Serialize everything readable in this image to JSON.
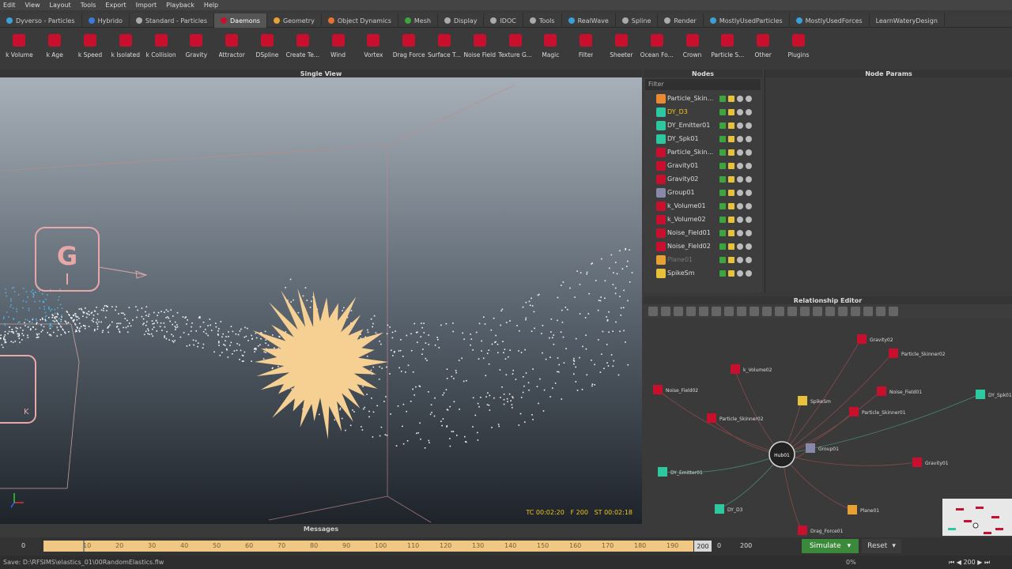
{
  "menu": [
    "Edit",
    "View",
    "Layout",
    "Tools",
    "Export",
    "Import",
    "Playback",
    "Help"
  ],
  "tabs": [
    {
      "label": "Dyverso - Particles",
      "icon": "dyverso-icon",
      "color": "#3aa0d8",
      "active": false
    },
    {
      "label": "Hybrido",
      "icon": "hybrido-icon",
      "color": "#3a7ad8",
      "active": false
    },
    {
      "label": "Standard - Particles",
      "icon": "particles-icon",
      "color": "#aaaaaa",
      "active": false
    },
    {
      "label": "Daemons",
      "icon": "daemon-icon",
      "color": "#c8102e",
      "active": true
    },
    {
      "label": "Geometry",
      "icon": "geometry-icon",
      "color": "#e8a030",
      "active": false
    },
    {
      "label": "Object Dynamics",
      "icon": "dynamics-icon",
      "color": "#e87030",
      "active": false
    },
    {
      "label": "Mesh",
      "icon": "mesh-icon",
      "color": "#3ca53c",
      "active": false
    },
    {
      "label": "Display",
      "icon": "display-icon",
      "color": "#aaaaaa",
      "active": false
    },
    {
      "label": "IDOC",
      "icon": "idoc-icon",
      "color": "#aaaaaa",
      "active": false
    },
    {
      "label": "Tools",
      "icon": "tools-icon",
      "color": "#aaaaaa",
      "active": false
    },
    {
      "label": "RealWave",
      "icon": "realwave-icon",
      "color": "#3aa0d8",
      "active": false
    },
    {
      "label": "Spline",
      "icon": "spline-icon",
      "color": "#aaaaaa",
      "active": false
    },
    {
      "label": "Render",
      "icon": "render-icon",
      "color": "#aaaaaa",
      "active": false
    },
    {
      "label": "MostlyUsedParticles",
      "icon": "favorites-icon",
      "color": "#3aa0d8",
      "active": false
    },
    {
      "label": "MostlyUsedForces",
      "icon": "favorites-icon",
      "color": "#3aa0d8",
      "active": false
    },
    {
      "label": "LearnWateryDesign",
      "icon": "",
      "color": "",
      "active": false
    }
  ],
  "shelf": [
    "k Volume",
    "k Age",
    "k Speed",
    "k Isolated",
    "k Collision",
    "Gravity",
    "Attractor",
    "DSpline",
    "Create Te...",
    "Wind",
    "Vortex",
    "Drag Force",
    "Surface T...",
    "Noise Field",
    "Texture G...",
    "Magic",
    "Filter",
    "Sheeter",
    "Ocean Fo...",
    "Crown",
    "Particle S...",
    "Other",
    "Plugins"
  ],
  "viewport": {
    "title": "Single View",
    "tc": "TC 00:02:20",
    "frame": "F 200",
    "st": "ST 00:02:18",
    "gizmo_g": "G",
    "gizmo_k": "K"
  },
  "nodes": {
    "title": "Nodes",
    "filter_placeholder": "Filter",
    "items": [
      {
        "name": "Particle_Skin...",
        "color": "#e88a30"
      },
      {
        "name": "DY_D3",
        "color": "#2ec8a0",
        "highlight": true
      },
      {
        "name": "DY_Emitter01",
        "color": "#2ec8a0"
      },
      {
        "name": "DY_Spk01",
        "color": "#2ec8a0"
      },
      {
        "name": "Particle_Skin...",
        "color": "#c8102e"
      },
      {
        "name": "Gravity01",
        "color": "#c8102e"
      },
      {
        "name": "Gravity02",
        "color": "#c8102e"
      },
      {
        "name": "Group01",
        "color": "#8888aa"
      },
      {
        "name": "k_Volume01",
        "color": "#c8102e"
      },
      {
        "name": "k_Volume02",
        "color": "#c8102e"
      },
      {
        "name": "Noise_Field01",
        "color": "#c8102e"
      },
      {
        "name": "Noise_Field02",
        "color": "#c8102e"
      },
      {
        "name": "Plane01",
        "color": "#e8a030",
        "dim": true
      },
      {
        "name": "SpikeSm",
        "color": "#e8c13c"
      }
    ]
  },
  "params": {
    "title": "Node Params"
  },
  "relationship": {
    "title": "Relationship Editor",
    "hub": "Hub01",
    "nodes": [
      {
        "label": "Gravity02",
        "color": "#c8102e"
      },
      {
        "label": "Particle_Skinner02",
        "color": "#c8102e"
      },
      {
        "label": "k_Volume02",
        "color": "#c8102e"
      },
      {
        "label": "Noise_Field02",
        "color": "#c8102e"
      },
      {
        "label": "SpikeSm",
        "color": "#e8c13c"
      },
      {
        "label": "Noise_Field01",
        "color": "#c8102e"
      },
      {
        "label": "Particle_Skinner01",
        "color": "#c8102e"
      },
      {
        "label": "Particle_Skinner02",
        "color": "#c8102e"
      },
      {
        "label": "Group01",
        "color": "#8888aa"
      },
      {
        "label": "DY_Spk01",
        "color": "#2ec8a0"
      },
      {
        "label": "DY_Emitter01",
        "color": "#2ec8a0"
      },
      {
        "label": "Gravity01",
        "color": "#c8102e"
      },
      {
        "label": "DY_D3",
        "color": "#2ec8a0"
      },
      {
        "label": "Drag_Force01",
        "color": "#c8102e"
      },
      {
        "label": "Plane01",
        "color": "#e8a030"
      }
    ]
  },
  "messages": {
    "title": "Messages"
  },
  "timeline": {
    "start": "0",
    "ticks": [
      "10",
      "20",
      "30",
      "40",
      "50",
      "60",
      "70",
      "80",
      "90",
      "100",
      "110",
      "120",
      "130",
      "140",
      "150",
      "160",
      "170",
      "180",
      "190"
    ],
    "current": "200",
    "range_start": "0",
    "range_end": "200",
    "simulate": "Simulate",
    "reset": "Reset"
  },
  "status": {
    "text": "Save: D:\\RFSIMS\\elastics_01\\00RandomElastics.flw",
    "percent": "0%",
    "frame": "200"
  }
}
